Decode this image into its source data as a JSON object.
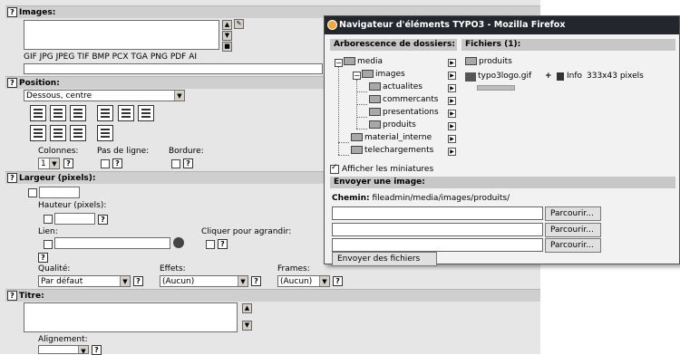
{
  "form": {
    "images_header": "Images:",
    "file_types": "GIF JPG JPEG TIF BMP PCX TGA PNG PDF AI",
    "position_header": "Position:",
    "position_value": "Dessous, centre",
    "columns_label": "Colonnes:",
    "columns_value": "1",
    "nowrap_label": "Pas de ligne:",
    "border_label": "Bordure:",
    "width_header": "Largeur (pixels):",
    "height_label": "Hauteur (pixels):",
    "link_label": "Lien:",
    "enlarge_label": "Cliquer pour agrandir:",
    "quality_label": "Qualité:",
    "quality_value": "Par défaut",
    "effects_label": "Effets:",
    "effects_value": "(Aucun)",
    "frames_label": "Frames:",
    "frames_value": "(Aucun)",
    "title_header": "Titre:",
    "alignment_label": "Alignement:",
    "help_glyph": "?"
  },
  "popup": {
    "window_title": "Navigateur d'éléments TYPO3 - Mozilla Firefox",
    "tree_header": "Arborescence de dossiers:",
    "files_header": "Fichiers (1):",
    "tree": [
      "media",
      "images",
      "actualites",
      "commercants",
      "presentations",
      "produits",
      "material_interne",
      "telechargements"
    ],
    "files_folder": "produits",
    "file_name": "typo3logo.gif",
    "file_info": "Info",
    "file_dims": "333x43 pixels",
    "thumbs_label": "Afficher les miniatures",
    "upload_header": "Envoyer une image:",
    "path_label": "Chemin:",
    "path_value": "fileadmin/media/images/produits/",
    "browse_label": "Parcourir...",
    "submit_label": "Envoyer des fichiers"
  }
}
